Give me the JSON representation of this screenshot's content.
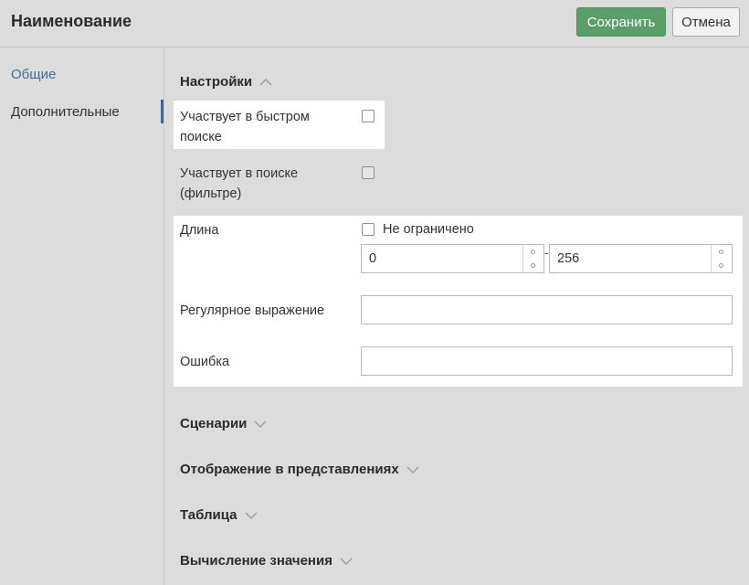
{
  "header": {
    "title": "Наименование",
    "save_label": "Сохранить",
    "cancel_label": "Отмена"
  },
  "sidebar": {
    "items": [
      {
        "label": "Общие",
        "active": true
      },
      {
        "label": "Дополнительные",
        "active": false
      }
    ]
  },
  "settings": {
    "title": "Настройки",
    "expanded": true,
    "fields": {
      "quick_search": {
        "label": "Участвует в быстром поиске",
        "checked": false
      },
      "filter_search": {
        "label": "Участвует в поиске (фильтре)",
        "checked": false
      },
      "length": {
        "label": "Длина",
        "unlimited_label": "Не ограничено",
        "unlimited_checked": false,
        "min": "0",
        "separator": "-",
        "max": "256"
      },
      "regex": {
        "label": "Регулярное выражение",
        "value": ""
      },
      "error": {
        "label": "Ошибка",
        "value": ""
      }
    }
  },
  "sections": [
    {
      "title": "Сценарии",
      "expanded": false
    },
    {
      "title": "Отображение в представлениях",
      "expanded": false
    },
    {
      "title": "Таблица",
      "expanded": false
    },
    {
      "title": "Вычисление значения",
      "expanded": false
    }
  ],
  "colors": {
    "save_button": "#5a9e6a",
    "active_nav": "#3f6f99",
    "background": "#dcdcdc"
  }
}
